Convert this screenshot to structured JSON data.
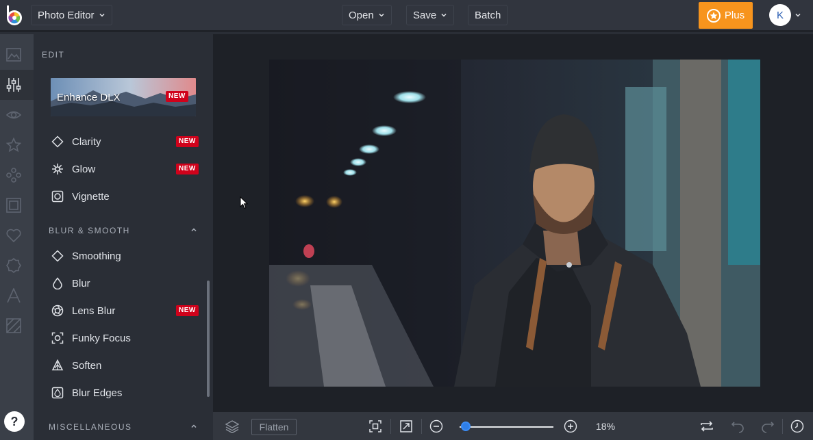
{
  "topbar": {
    "app_name": "Photo Editor",
    "menu": [
      {
        "label": "Open"
      },
      {
        "label": "Save"
      },
      {
        "label": "Batch"
      }
    ],
    "plus_label": "Plus",
    "avatar_initial": "K",
    "accent_color": "#f7941d"
  },
  "rail": {
    "icons": [
      "image-icon",
      "adjust-sliders-icon",
      "eye-icon",
      "star-icon",
      "shapes-icon",
      "frame-icon",
      "heart-icon",
      "badge-icon",
      "text-icon",
      "texture-icon"
    ],
    "help_label": "?"
  },
  "panel": {
    "edit_title": "EDIT",
    "enhance": {
      "label": "Enhance DLX",
      "badge": "NEW"
    },
    "tools_edit": [
      {
        "label": "Clarity",
        "icon": "diamond-icon",
        "badge": "NEW"
      },
      {
        "label": "Glow",
        "icon": "sparkle-icon",
        "badge": "NEW"
      },
      {
        "label": "Vignette",
        "icon": "vignette-icon",
        "badge": ""
      }
    ],
    "blur_title": "BLUR & SMOOTH",
    "tools_blur": [
      {
        "label": "Smoothing",
        "icon": "diamond-icon",
        "badge": ""
      },
      {
        "label": "Blur",
        "icon": "droplet-icon",
        "badge": ""
      },
      {
        "label": "Lens Blur",
        "icon": "aperture-icon",
        "badge": "NEW"
      },
      {
        "label": "Funky Focus",
        "icon": "focus-icon",
        "badge": ""
      },
      {
        "label": "Soften",
        "icon": "soften-icon",
        "badge": ""
      },
      {
        "label": "Blur Edges",
        "icon": "blur-edges-icon",
        "badge": ""
      }
    ],
    "misc_title": "MISCELLANEOUS",
    "badge_color": "#d0021b"
  },
  "bottombar": {
    "flatten_label": "Flatten",
    "zoom_value": "18",
    "zoom_unit": "%",
    "zoom_level": 0.05
  }
}
